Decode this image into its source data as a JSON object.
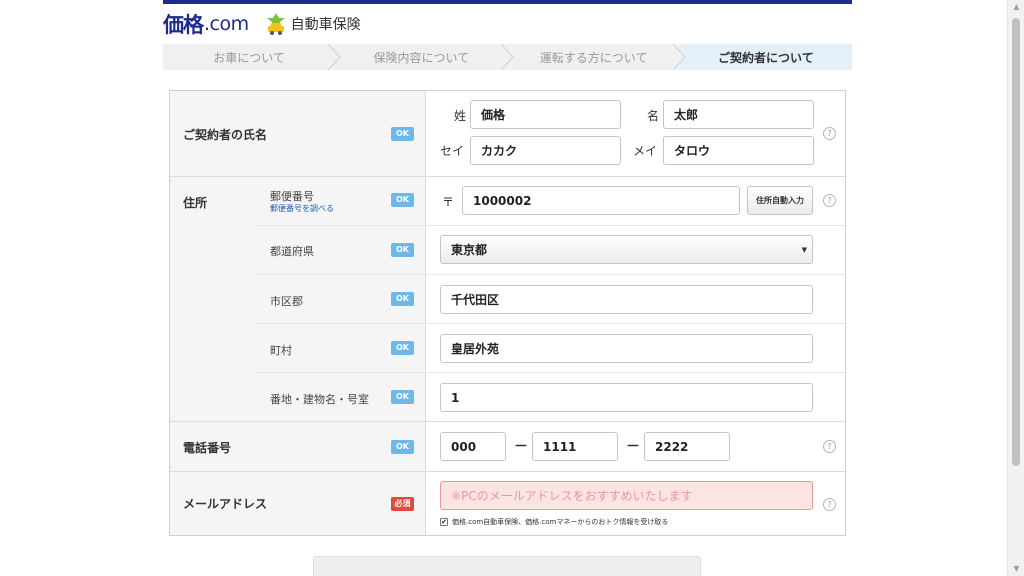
{
  "header": {
    "logo_main": "価格",
    "logo_suffix": ".com",
    "service_name": "自動車保険"
  },
  "steps": [
    {
      "label": "お車について",
      "active": false
    },
    {
      "label": "保険内容について",
      "active": false
    },
    {
      "label": "運転する方について",
      "active": false
    },
    {
      "label": "ご契約者について",
      "active": true
    }
  ],
  "form": {
    "name": {
      "label": "ご契約者の氏名",
      "badge": "OK",
      "last_label": "姓",
      "last_value": "価格",
      "first_label": "名",
      "first_value": "太郎",
      "last_kana_label": "セイ",
      "last_kana_value": "カカク",
      "first_kana_label": "メイ",
      "first_kana_value": "タロウ"
    },
    "address": {
      "label": "住所",
      "postal": {
        "label": "郵便番号",
        "link": "郵便番号を調べる",
        "badge": "OK",
        "symbol": "〒",
        "value": "1000002",
        "button": "住所自動入力"
      },
      "prefecture": {
        "label": "都道府県",
        "badge": "OK",
        "value": "東京都"
      },
      "city": {
        "label": "市区郡",
        "badge": "OK",
        "value": "千代田区"
      },
      "town": {
        "label": "町村",
        "badge": "OK",
        "value": "皇居外苑"
      },
      "street": {
        "label": "番地・建物名・号室",
        "badge": "OK",
        "value": "1"
      }
    },
    "phone": {
      "label": "電話番号",
      "badge": "OK",
      "part1": "000",
      "part2": "1111",
      "part3": "2222",
      "separator": "－"
    },
    "email": {
      "label": "メールアドレス",
      "badge": "必須",
      "placeholder": "※PCのメールアドレスをおすすめいたします",
      "value": "",
      "optin_checked": true,
      "optin_label": "価格.com自動車保険、価格.comマネーからのおトク情報を受け取る"
    },
    "help_symbol": "?"
  },
  "colors": {
    "brand": "#1e2a8c",
    "badge_ok": "#6db8e8",
    "badge_required": "#e04a3f",
    "error_field": "#fce4e4",
    "active_step": "#e4f0f9"
  },
  "icons": {
    "service": "car-insurance-icon",
    "help": "help-circle-icon",
    "caret": "chevron-down-icon",
    "checkbox": "checkbox-icon"
  }
}
